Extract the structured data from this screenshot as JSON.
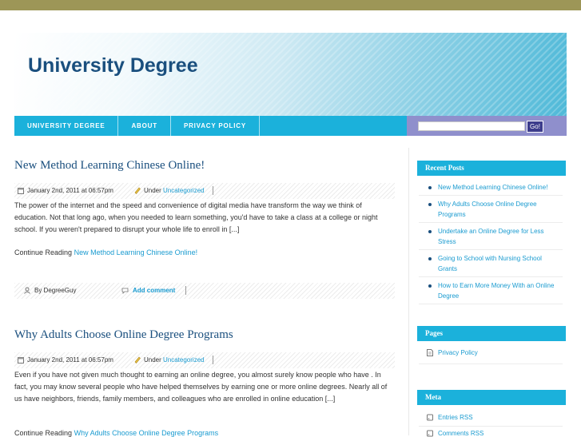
{
  "site": {
    "title": "University Degree"
  },
  "nav": {
    "items": [
      "UNIVERSITY DEGREE",
      "ABOUT",
      "PRIVACY POLICY"
    ]
  },
  "search": {
    "value": "",
    "button": "Go!"
  },
  "posts": [
    {
      "title": "New Method Learning Chinese Online!",
      "date": "January 2nd, 2011 at 06:57pm",
      "under_label": "Under",
      "category": "Uncategorized",
      "excerpt": "The power of the internet and the speed and convenience of digital media have transform the way we think of education. Not that long ago, when you needed to learn something, you'd have to take a class at a college or night school. If you weren't prepared to disrupt your whole life to enroll in [...]",
      "continue_label": "Continue Reading",
      "continue_link": "New Method Learning Chinese Online!",
      "author": "By DegreeGuy",
      "comment": "Add comment"
    },
    {
      "title": "Why Adults Choose Online Degree Programs",
      "date": "January 2nd, 2011 at 06:57pm",
      "under_label": "Under",
      "category": "Uncategorized",
      "excerpt": "Even if you have not given much thought to earning an online degree, you  almost surely  know people who have .  In fact, you may know several people who have helped themselves  by earning one or more online degrees.  Nearly all of us have neighbors, friends, family members, and colleagues   who are enrolled in online education [...]",
      "continue_label": "Continue Reading",
      "continue_link": "Why Adults Choose Online Degree Programs"
    }
  ],
  "sidebar": {
    "recent_title": "Recent Posts",
    "recent": [
      "New Method Learning Chinese Online!",
      "Why Adults Choose Online Degree Programs",
      "Undertake an Online Degree for Less Stress",
      "Going to School with Nursing School Grants",
      "How to Earn More Money With an Online Degree"
    ],
    "pages_title": "Pages",
    "pages": [
      "Privacy Policy"
    ],
    "meta_title": "Meta",
    "meta": [
      "Entries RSS",
      "Comments RSS"
    ]
  },
  "colors": {
    "accent": "#1bb1db",
    "title": "#1a4f7e",
    "topbar": "#9d9657",
    "search_bg": "#8f8fcc"
  }
}
